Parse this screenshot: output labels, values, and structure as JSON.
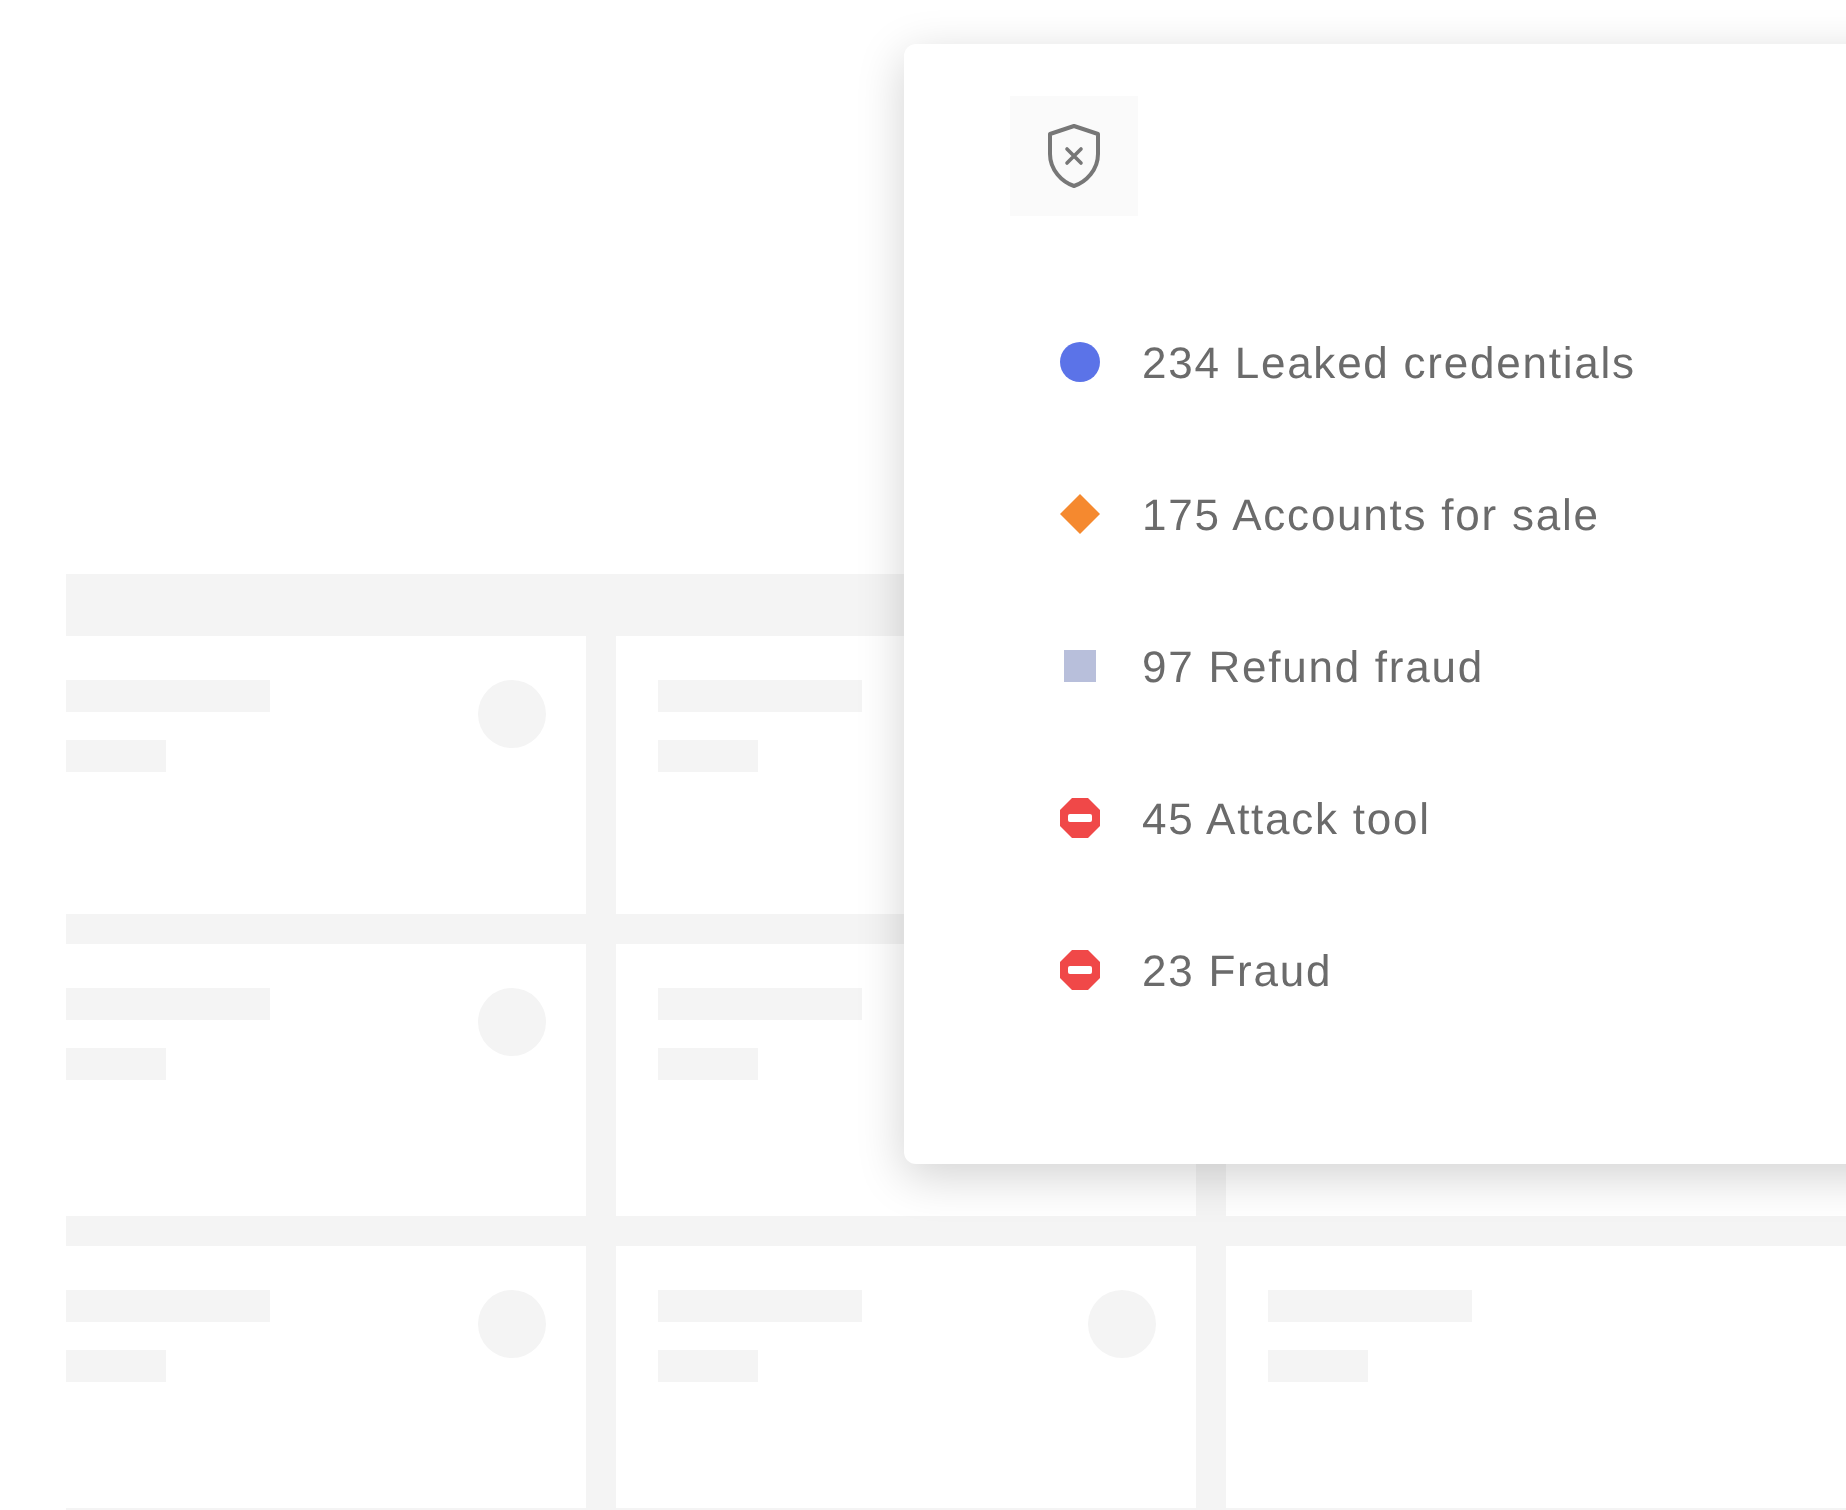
{
  "legend": {
    "items": [
      {
        "kind": "circle",
        "color": "#5b73e8",
        "label": "234 Leaked credentials"
      },
      {
        "kind": "diamond",
        "color": "#f5892f",
        "label": "175 Accounts for sale"
      },
      {
        "kind": "square",
        "color": "#b8bfdb",
        "label": "97 Refund fraud"
      },
      {
        "kind": "stop",
        "color": "#f04848",
        "label": "45 Attack tool"
      },
      {
        "kind": "stop",
        "color": "#f04848",
        "label": "23 Fraud"
      }
    ]
  }
}
